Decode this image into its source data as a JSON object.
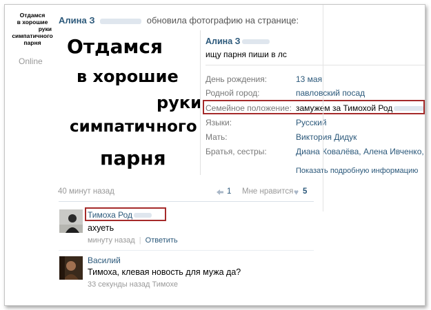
{
  "avatar_caption": [
    "Отдамся",
    "в хорошие",
    "руки",
    "симпатичного",
    "парня"
  ],
  "presence": "Online",
  "post": {
    "author": "Алина З",
    "action": "обновила фотографию на странице:",
    "image_text": [
      "Отдамся",
      "в хорошие",
      "руки",
      "симпатичного",
      "парня"
    ],
    "time": "40 минут назад",
    "reposts": "1",
    "like_label": "Мне нравится",
    "likes": "5"
  },
  "profile_card": {
    "name": "Алина З",
    "status": "ищу парня пиши в лс",
    "rows": [
      {
        "label": "День рождения:",
        "value": "13 мая"
      },
      {
        "label": "Родной город:",
        "value": "павловский посад"
      },
      {
        "label": "Семейное положение:",
        "value": "замужем за Тимохой Род"
      },
      {
        "label": "Языки:",
        "value": "Русский"
      },
      {
        "label": "Мать:",
        "value": "Виктория Дидук"
      },
      {
        "label": "Братья, сестры:",
        "value": "Диана Ковалёва, Алена Ивченко, Мих"
      }
    ],
    "more_link": "Показать подробную информацию"
  },
  "comments": [
    {
      "author": "Тимоха Род",
      "text": "ахуеть",
      "time": "минуту назад",
      "reply": "Ответить"
    },
    {
      "author": "Василий",
      "text": "Тимоха, клевая новость для мужа да?",
      "time": "33 секунды назад Тимохе"
    }
  ],
  "colors": {
    "link": "#2b587a",
    "highlight_border": "#a52a2a",
    "muted": "#999999"
  }
}
